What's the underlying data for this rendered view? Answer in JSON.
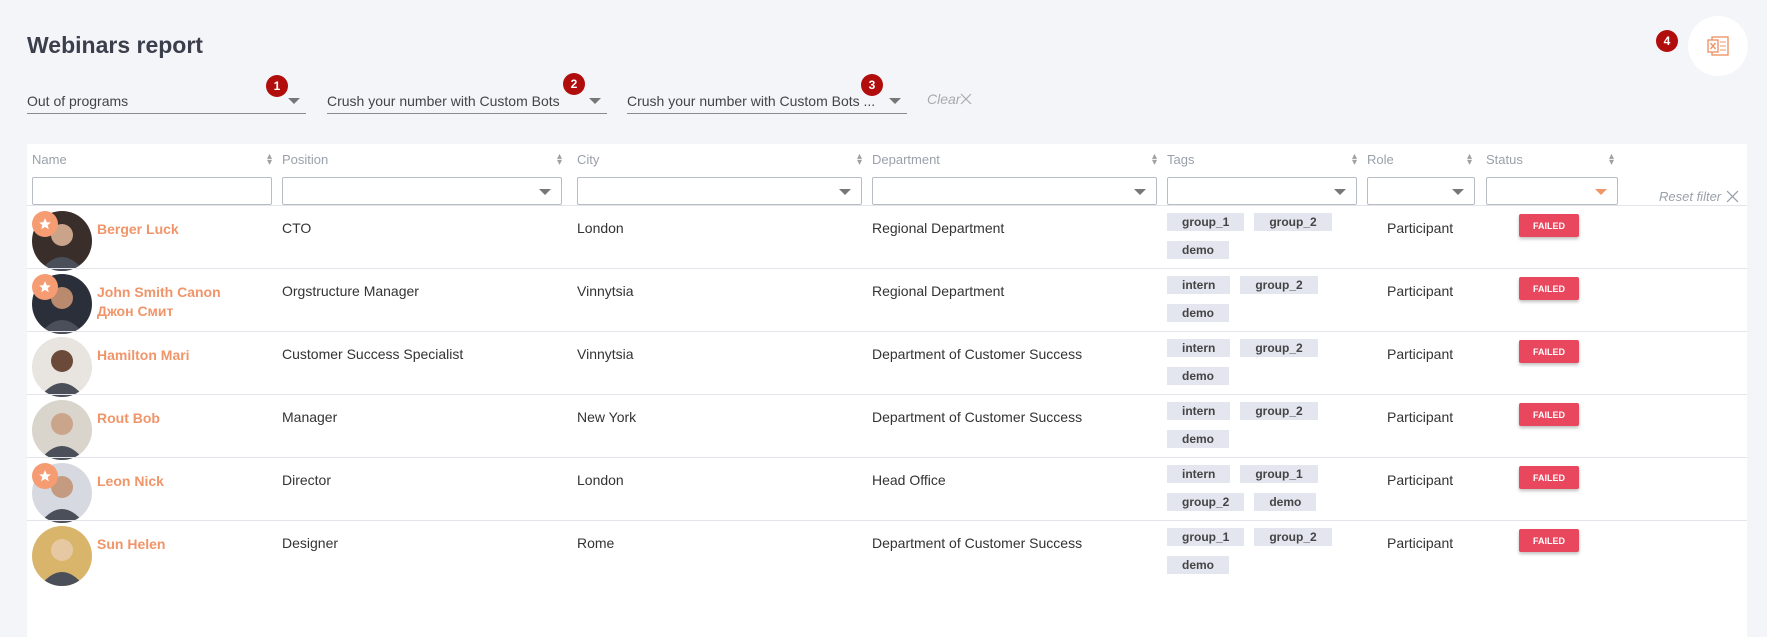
{
  "page": {
    "title": "Webinars report"
  },
  "export": {
    "icon": "excel-icon",
    "badge": "4"
  },
  "filters": [
    {
      "label": "Out of programs",
      "badge": "1"
    },
    {
      "label": "Crush your number with Custom Bots",
      "badge": "2"
    },
    {
      "label": "Crush your number with Custom Bots ...",
      "badge": "3"
    }
  ],
  "clear_label": "Clear",
  "columns": {
    "name": "Name",
    "position": "Position",
    "city": "City",
    "department": "Department",
    "tags": "Tags",
    "role": "Role",
    "status": "Status"
  },
  "reset_filter": "Reset filter",
  "colors": {
    "accent": "#f0956a",
    "failed": "#e8475d",
    "badge": "#b10d0d"
  },
  "rows": [
    {
      "name": "Berger Luck",
      "position": "CTO",
      "city": "London",
      "department": "Regional Department",
      "tags": [
        "group_1",
        "group_2",
        "demo"
      ],
      "role": "Participant",
      "status": "FAILED",
      "starred": true
    },
    {
      "name": "John Smith Canon Джон Смит",
      "position": "Orgstructure Manager",
      "city": "Vinnytsia",
      "department": "Regional Department",
      "tags": [
        "intern",
        "group_2",
        "demo"
      ],
      "role": "Participant",
      "status": "FAILED",
      "starred": true
    },
    {
      "name": "Hamilton Mari",
      "position": "Customer Success Specialist",
      "city": "Vinnytsia",
      "department": "Department of Customer Success",
      "tags": [
        "intern",
        "group_2",
        "demo"
      ],
      "role": "Participant",
      "status": "FAILED",
      "starred": false
    },
    {
      "name": "Rout Bob",
      "position": "Manager",
      "city": "New York",
      "department": "Department of Customer Success",
      "tags": [
        "intern",
        "group_2",
        "demo"
      ],
      "role": "Participant",
      "status": "FAILED",
      "starred": false
    },
    {
      "name": "Leon Nick",
      "position": "Director",
      "city": "London",
      "department": "Head Office",
      "tags": [
        "intern",
        "group_1",
        "group_2",
        "demo"
      ],
      "role": "Participant",
      "status": "FAILED",
      "starred": true
    },
    {
      "name": "Sun Helen",
      "position": "Designer",
      "city": "Rome",
      "department": "Department of Customer Success",
      "tags": [
        "group_1",
        "group_2",
        "demo"
      ],
      "role": "Participant",
      "status": "FAILED",
      "starred": false
    }
  ]
}
